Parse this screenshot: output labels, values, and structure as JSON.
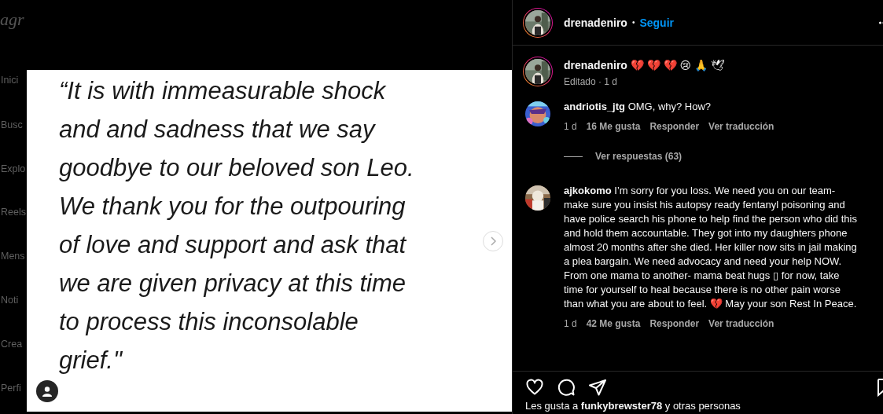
{
  "sidebar": {
    "logo": "agr",
    "items": [
      {
        "label": "Inici"
      },
      {
        "label": "Busc"
      },
      {
        "label": "Explo"
      },
      {
        "label": "Reels"
      },
      {
        "label": "Mens"
      },
      {
        "label": "Noti"
      },
      {
        "label": "Crea"
      },
      {
        "label": "Perfi"
      }
    ]
  },
  "post": {
    "quote": "“It is with immeasurable shock\nand and sadness that we say\ngoodbye to our beloved son Leo.\nWe thank you for the outpouring\nof love and support and ask that\nwe are given privacy at this time\nto process this inconsolable\ngrief.\""
  },
  "header": {
    "username": "drenadeniro",
    "separator": "•",
    "follow": "Seguir"
  },
  "caption": {
    "username": "drenadeniro",
    "text": "💔 💔 💔 😢 🙏 🕊",
    "meta": "Editado · 1 d"
  },
  "comments": [
    {
      "username": "andriotis_jtg",
      "text": "OMG, why? How?",
      "time": "1 d",
      "likes": "16 Me gusta",
      "reply": "Responder",
      "translate": "Ver traducción",
      "replies": "Ver respuestas (63)"
    },
    {
      "username": "ajkokomo",
      "text": "I’m sorry for you loss. We need you on our team- make sure you insist his autopsy ready fentanyl poisoning and have police search his phone to help find the person who did this and hold them accountable. They got into my daughters phone almost 20 months after she died. Her killer now sits in jail making a plea bargain. We need advocacy and need your help NOW. From one mama to another- mama beat hugs ▯ for now, take time for yourself to heal because there is no other pain worse than what you are about to feel. 💔  May your son Rest In Peace.",
      "time": "1 d",
      "likes": "42 Me gusta",
      "reply": "Responder",
      "translate": "Ver traducción"
    }
  ],
  "likes_line": "Les gusta a **funkybrewster78** y otras personas"
}
